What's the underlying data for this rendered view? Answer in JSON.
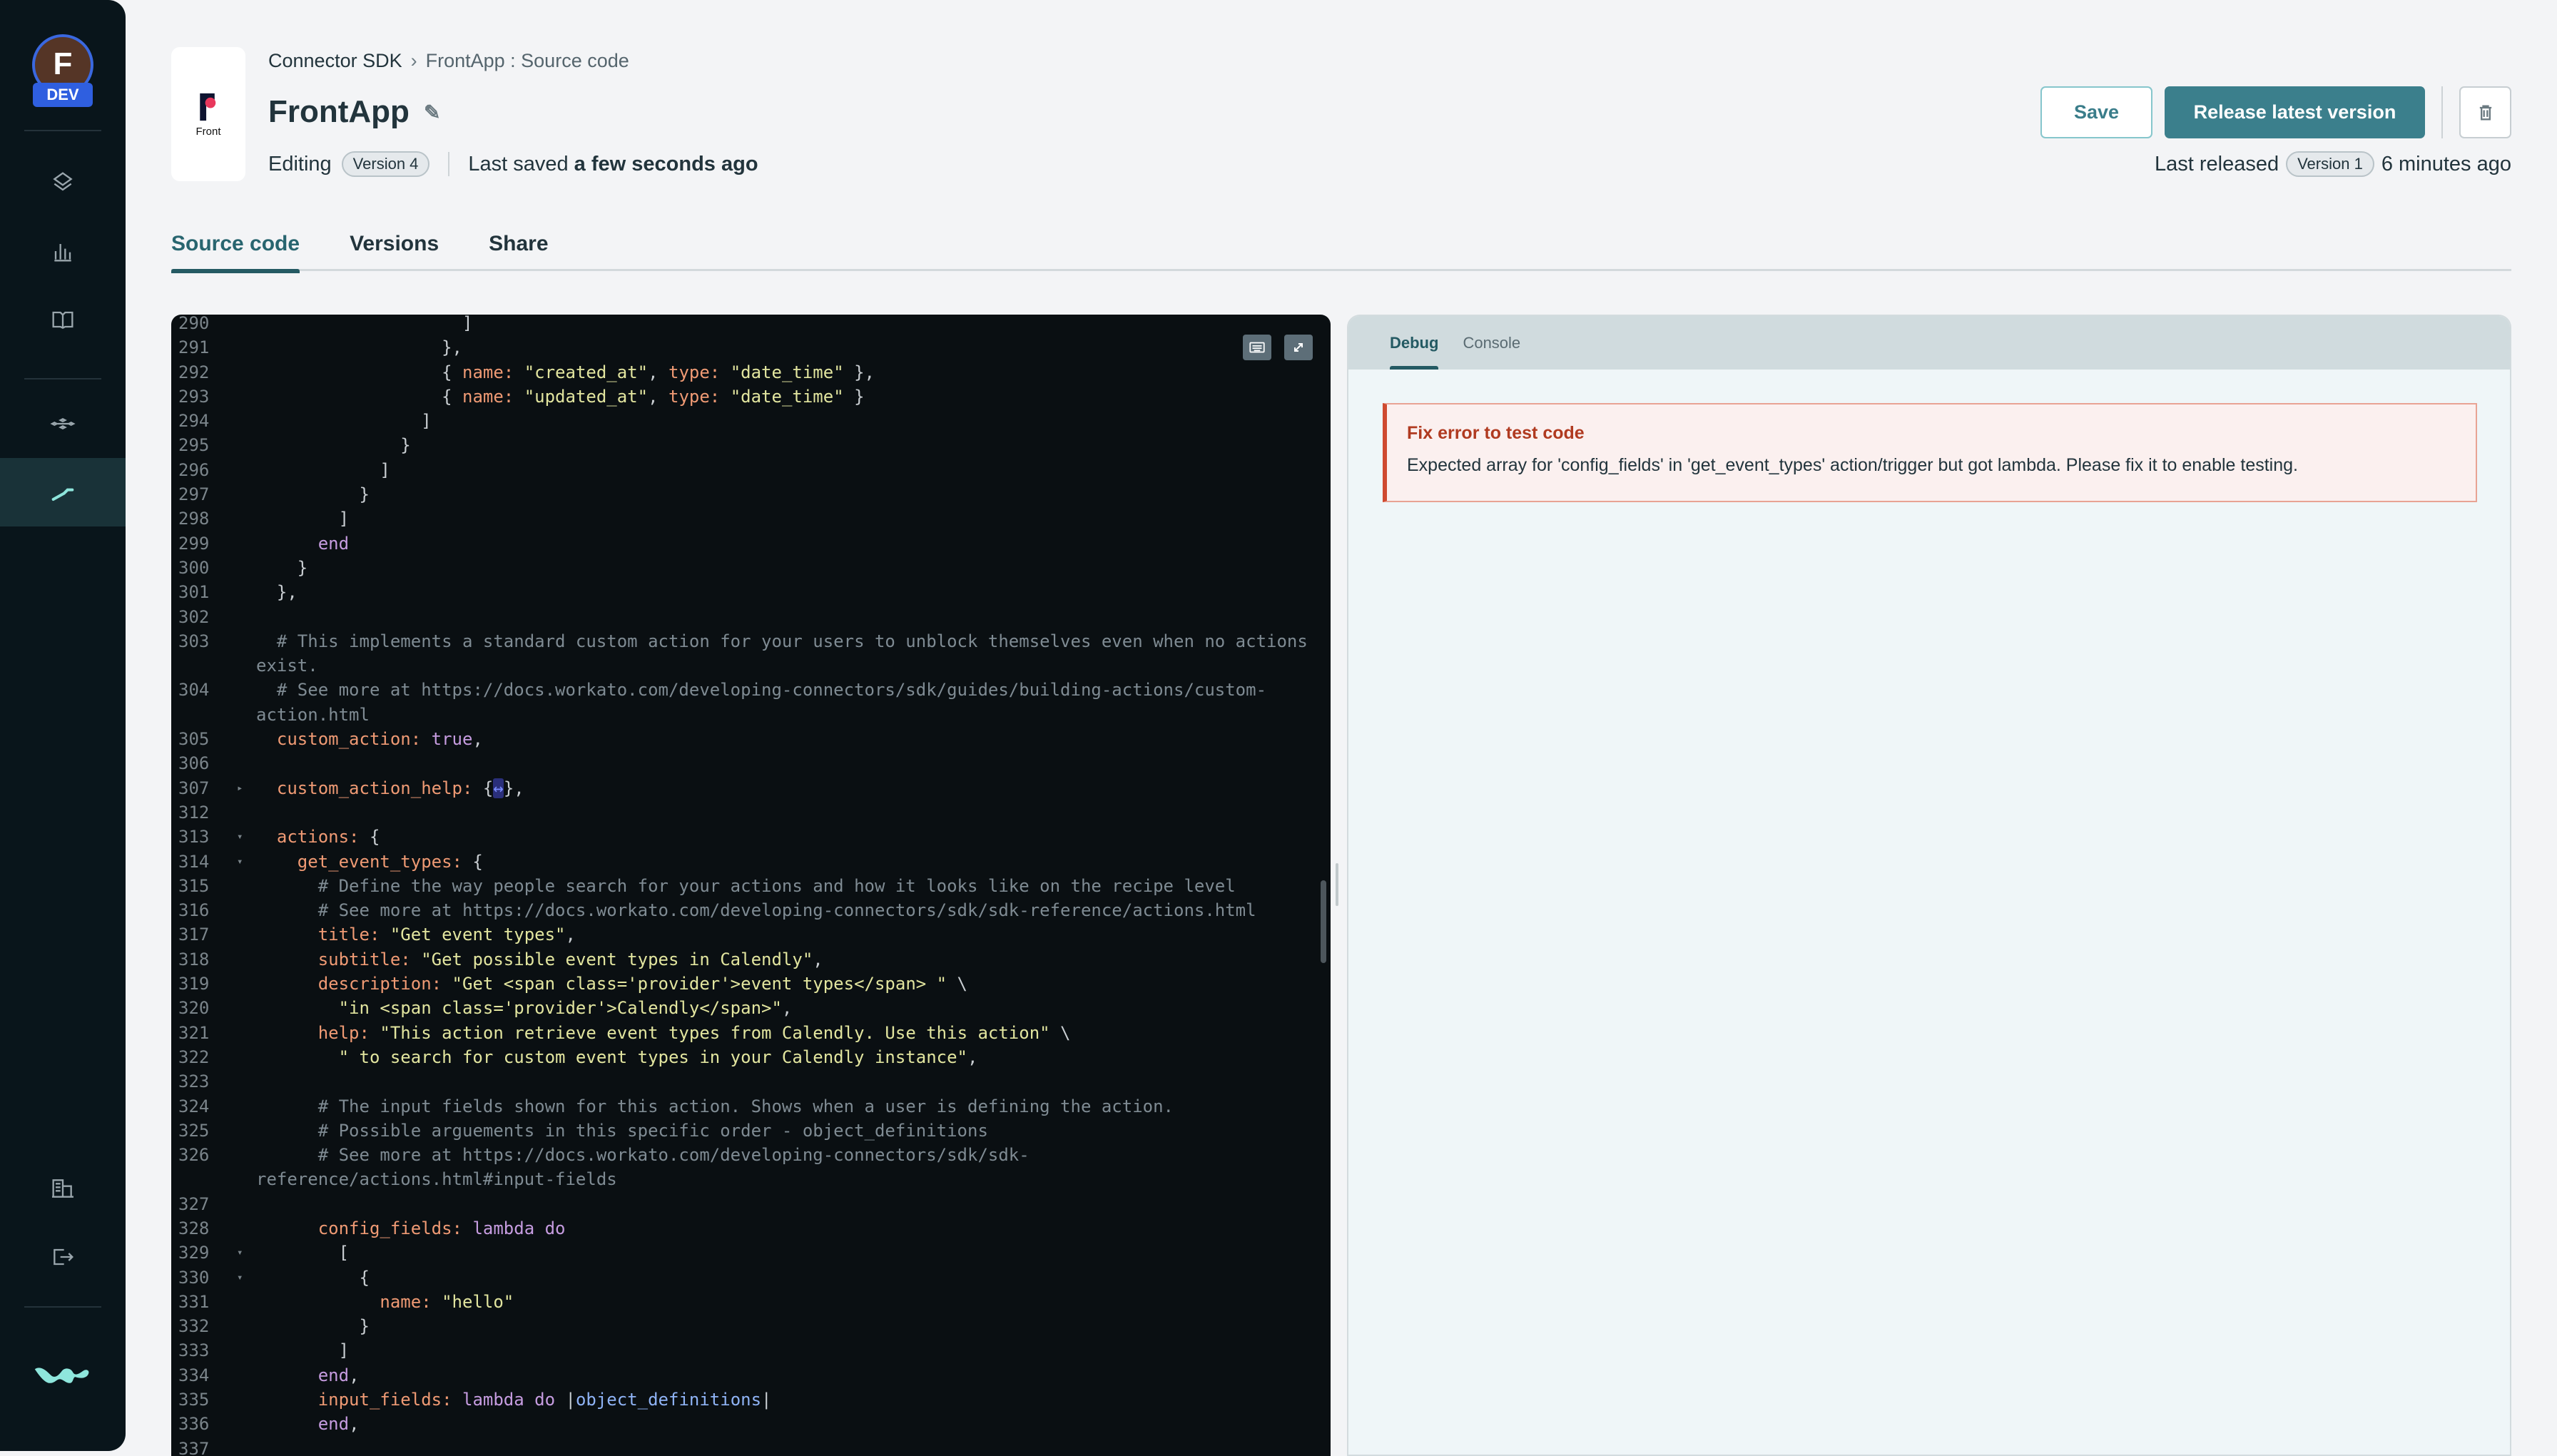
{
  "sidebar": {
    "avatar_letter": "F",
    "env_badge": "DEV",
    "items": [
      "layers-icon",
      "chart-icon",
      "book-icon",
      "workflow-icon",
      "wrench-icon",
      "org-icon",
      "logout-icon"
    ],
    "active": "wrench-icon"
  },
  "header": {
    "logo_text": "Front",
    "breadcrumb": [
      "Connector SDK",
      "FrontApp : Source code"
    ],
    "title": "FrontApp",
    "editing_label": "Editing",
    "editing_version": "Version 4",
    "last_saved_prefix": "Last saved",
    "last_saved_value": "a few seconds ago",
    "save_label": "Save",
    "release_label": "Release latest version",
    "last_released_label": "Last released",
    "released_version": "Version 1",
    "released_ago": "6 minutes ago"
  },
  "tabs": [
    {
      "label": "Source code",
      "active": true
    },
    {
      "label": "Versions"
    },
    {
      "label": "Share"
    }
  ],
  "editor": {
    "lines": [
      {
        "n": "290",
        "t": [
          [
            "p",
            "                    ]"
          ]
        ]
      },
      {
        "n": "291",
        "t": [
          [
            "p",
            "                  },"
          ]
        ]
      },
      {
        "n": "292",
        "t": [
          [
            "p",
            "                  { "
          ],
          [
            "k",
            "name:"
          ],
          [
            "p",
            " "
          ],
          [
            "s",
            "\"created_at\""
          ],
          [
            "p",
            ", "
          ],
          [
            "k",
            "type:"
          ],
          [
            "p",
            " "
          ],
          [
            "s",
            "\"date_time\""
          ],
          [
            "p",
            " },"
          ]
        ]
      },
      {
        "n": "293",
        "t": [
          [
            "p",
            "                  { "
          ],
          [
            "k",
            "name:"
          ],
          [
            "p",
            " "
          ],
          [
            "s",
            "\"updated_at\""
          ],
          [
            "p",
            ", "
          ],
          [
            "k",
            "type:"
          ],
          [
            "p",
            " "
          ],
          [
            "s",
            "\"date_time\""
          ],
          [
            "p",
            " }"
          ]
        ]
      },
      {
        "n": "294",
        "t": [
          [
            "p",
            "                ]"
          ]
        ]
      },
      {
        "n": "295",
        "t": [
          [
            "p",
            "              }"
          ]
        ]
      },
      {
        "n": "296",
        "t": [
          [
            "p",
            "            ]"
          ]
        ]
      },
      {
        "n": "297",
        "t": [
          [
            "p",
            "          }"
          ]
        ]
      },
      {
        "n": "298",
        "t": [
          [
            "p",
            "        ]"
          ]
        ]
      },
      {
        "n": "299",
        "t": [
          [
            "kw",
            "      end"
          ]
        ]
      },
      {
        "n": "300",
        "t": [
          [
            "p",
            "    }"
          ]
        ]
      },
      {
        "n": "301",
        "t": [
          [
            "p",
            "  },"
          ]
        ]
      },
      {
        "n": "302",
        "t": [
          [
            "p",
            ""
          ]
        ]
      },
      {
        "n": "303",
        "t": [
          [
            "c",
            "  # This implements a standard custom action for your users to unblock themselves even when no actions exist."
          ]
        ]
      },
      {
        "n": "304",
        "t": [
          [
            "c",
            "  # See more at https://docs.workato.com/developing-connectors/sdk/guides/building-actions/custom-action.html"
          ]
        ]
      },
      {
        "n": "305",
        "t": [
          [
            "k",
            "  custom_action:"
          ],
          [
            "p",
            " "
          ],
          [
            "kw",
            "true"
          ],
          [
            "p",
            ","
          ]
        ]
      },
      {
        "n": "306",
        "t": [
          [
            "p",
            ""
          ]
        ]
      },
      {
        "n": "307",
        "fold": "▸",
        "t": [
          [
            "k",
            "  custom_action_help:"
          ],
          [
            "p",
            " {"
          ],
          [
            "chip",
            "↔"
          ],
          [
            "p",
            "},"
          ]
        ]
      },
      {
        "n": "312",
        "t": [
          [
            "p",
            ""
          ]
        ]
      },
      {
        "n": "313",
        "fold": "▾",
        "t": [
          [
            "k",
            "  actions:"
          ],
          [
            "p",
            " {"
          ]
        ]
      },
      {
        "n": "314",
        "fold": "▾",
        "t": [
          [
            "k",
            "    get_event_types:"
          ],
          [
            "p",
            " {"
          ]
        ]
      },
      {
        "n": "315",
        "t": [
          [
            "c",
            "      # Define the way people search for your actions and how it looks like on the recipe level"
          ]
        ]
      },
      {
        "n": "316",
        "t": [
          [
            "c",
            "      # See more at https://docs.workato.com/developing-connectors/sdk/sdk-reference/actions.html"
          ]
        ]
      },
      {
        "n": "317",
        "t": [
          [
            "k",
            "      title:"
          ],
          [
            "p",
            " "
          ],
          [
            "s",
            "\"Get event types\""
          ],
          [
            "p",
            ","
          ]
        ]
      },
      {
        "n": "318",
        "t": [
          [
            "k",
            "      subtitle:"
          ],
          [
            "p",
            " "
          ],
          [
            "s",
            "\"Get possible event types in Calendly\""
          ],
          [
            "p",
            ","
          ]
        ]
      },
      {
        "n": "319",
        "t": [
          [
            "k",
            "      description:"
          ],
          [
            "p",
            " "
          ],
          [
            "s",
            "\"Get <span class='provider'>event types</span> \""
          ],
          [
            "p",
            " \\"
          ]
        ]
      },
      {
        "n": "320",
        "t": [
          [
            "s",
            "        \"in <span class='provider'>Calendly</span>\""
          ],
          [
            "p",
            ","
          ]
        ]
      },
      {
        "n": "321",
        "t": [
          [
            "k",
            "      help:"
          ],
          [
            "p",
            " "
          ],
          [
            "s",
            "\"This action retrieve event types from Calendly. Use this action\""
          ],
          [
            "p",
            " \\"
          ]
        ]
      },
      {
        "n": "322",
        "t": [
          [
            "s",
            "        \" to search for custom event types in your Calendly instance\""
          ],
          [
            "p",
            ","
          ]
        ]
      },
      {
        "n": "323",
        "t": [
          [
            "p",
            ""
          ]
        ]
      },
      {
        "n": "324",
        "t": [
          [
            "c",
            "      # The input fields shown for this action. Shows when a user is defining the action."
          ]
        ]
      },
      {
        "n": "325",
        "t": [
          [
            "c",
            "      # Possible arguements in this specific order - object_definitions"
          ]
        ]
      },
      {
        "n": "326",
        "t": [
          [
            "c",
            "      # See more at https://docs.workato.com/developing-connectors/sdk/sdk-reference/actions.html#input-fields"
          ]
        ]
      },
      {
        "n": "327",
        "t": [
          [
            "p",
            ""
          ]
        ]
      },
      {
        "n": "328",
        "t": [
          [
            "k",
            "      config_fields:"
          ],
          [
            "p",
            " "
          ],
          [
            "kw",
            "lambda do"
          ]
        ]
      },
      {
        "n": "329",
        "fold": "▾",
        "t": [
          [
            "p",
            "        ["
          ]
        ]
      },
      {
        "n": "330",
        "fold": "▾",
        "t": [
          [
            "p",
            "          {"
          ]
        ]
      },
      {
        "n": "331",
        "t": [
          [
            "k",
            "            name:"
          ],
          [
            "p",
            " "
          ],
          [
            "s",
            "\"hello\""
          ]
        ]
      },
      {
        "n": "332",
        "t": [
          [
            "p",
            "          }"
          ]
        ]
      },
      {
        "n": "333",
        "t": [
          [
            "p",
            "        ]"
          ]
        ]
      },
      {
        "n": "334",
        "t": [
          [
            "kw",
            "      end"
          ],
          [
            "p",
            ","
          ]
        ]
      },
      {
        "n": "335",
        "t": [
          [
            "k",
            "      input_fields:"
          ],
          [
            "p",
            " "
          ],
          [
            "kw",
            "lambda do"
          ],
          [
            "p",
            " |"
          ],
          [
            "v",
            "object_definitions"
          ],
          [
            "p",
            "|"
          ]
        ]
      },
      {
        "n": "336",
        "t": [
          [
            "kw",
            "      end"
          ],
          [
            "p",
            ","
          ]
        ]
      },
      {
        "n": "337",
        "t": [
          [
            "p",
            ""
          ]
        ]
      }
    ]
  },
  "debug": {
    "tabs": [
      {
        "label": "Debug",
        "active": true
      },
      {
        "label": "Console"
      }
    ],
    "error_title": "Fix error to test code",
    "error_message": "Expected array for 'config_fields' in 'get_event_types' action/trigger but got lambda. Please fix it to enable testing."
  },
  "colors": {
    "accent": "#3b7f8c",
    "sidebar": "#09151b",
    "editor_bg": "#0a0f12",
    "error": "#cf4a30"
  }
}
